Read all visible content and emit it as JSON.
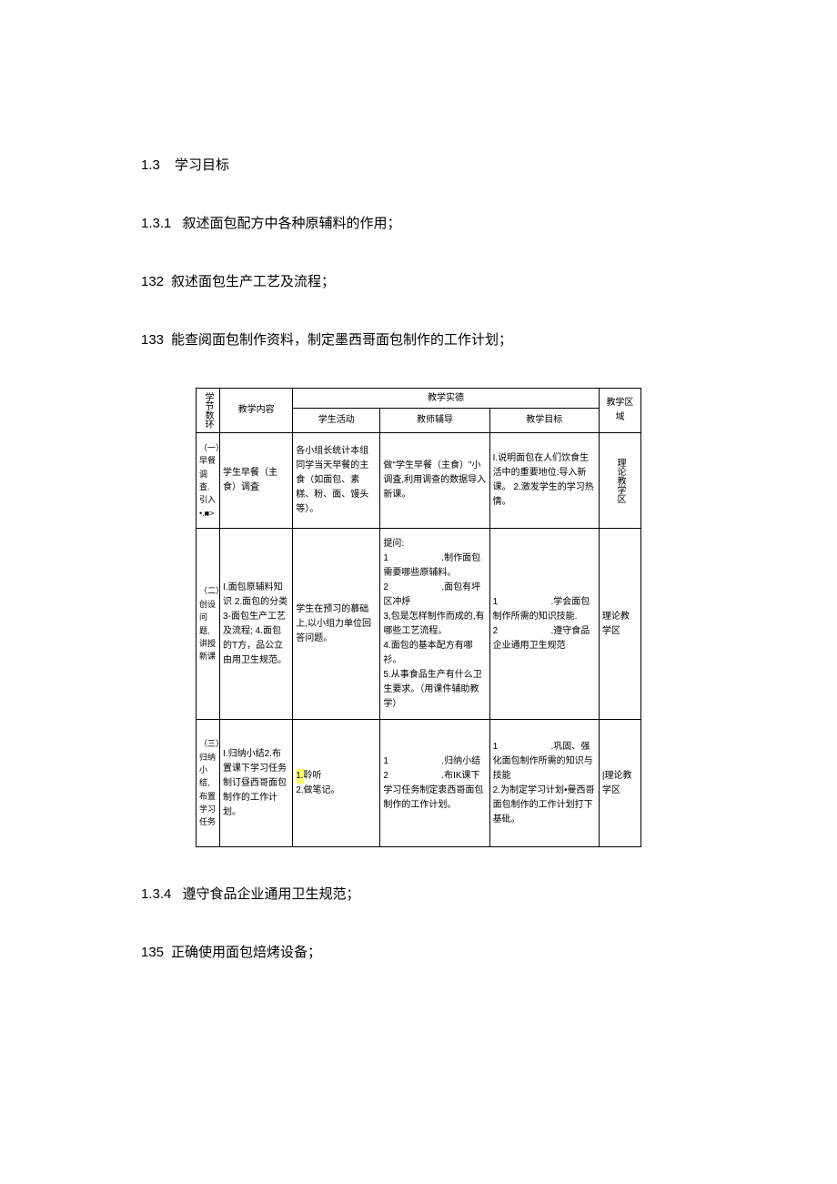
{
  "heading": {
    "num": "1.3",
    "text": "学习目标"
  },
  "items": [
    {
      "num": "1.3.1",
      "text": "叙述面包配方中各种原辅料的作用；"
    },
    {
      "num": "132",
      "text": "叙述面包生产工艺及流程；"
    },
    {
      "num": "133",
      "text": "能查阅面包制作资料，制定墨西哥面包制作的工作计划；"
    }
  ],
  "items_after": [
    {
      "num": "1.3.4",
      "text": "遵守食品企业通用卫生规范；"
    },
    {
      "num": "135",
      "text": "正确使用面包焙烤设备；"
    }
  ],
  "table": {
    "head": {
      "col1": "学节数环",
      "col2": "教学内容",
      "group": "教学实德",
      "sub1": "学生活动",
      "sub2": "教师辅导",
      "sub3": "教学目标",
      "col6": "教学区域"
    },
    "rows": [
      {
        "env": "（一）早餐调査.引入\n•.■>",
        "content": "学生早餐（主食）调査",
        "student": "各小组长统计本组同学当天早餐的主食（如面包、素糕、粉、面、馒头等）。",
        "teacher": "做\"学生早餐（主食）\"小调査,利用调查的数据导入新课。",
        "goal": "I.说明面包在人们饮食生活中的重要地位:导入新课。\n2.激发学生的学习热情。",
        "area": "理论教学区"
      },
      {
        "env": "（二）创设问题,讲授新课",
        "content": "I.面包原辅料知识\n2.面包的分类\n3-面包生产工艺及流程;\n4.面包的T方，品公立由用卫生规范。",
        "student": "学生在预习的慕础上,以小组力单位回答问题。",
        "teacher": "提问:\n1                     .制作面包需要哪些原辅料。\n2                     .面包有坪区冲烀\n3,包是怎样制作而成的,有哪些工艺流程。\n4.面包的基本配方有哪衫。\n5.从事食品生产有什么卫生要求。（用课件辅助教学）",
        "goal": "1                     .学会面包制作所需的知识技能.\n2                     .遵守食品企业通用卫生规范",
        "area": "理论教学区"
      },
      {
        "env": "（三）归纳小结,布置学习任务",
        "content": "I.归纳小结2.布置课下学习任务制订昼西哥面包制作的工作计划。",
        "student_hl": "1.",
        "student_rest": "聆听\n2.做笔记。",
        "teacher": "1                     .归纳小结\n2                     .布IK课下学习任务制定衷西哥面包制作的工作计划。",
        "goal": "1                     .巩固、强化面包制作所需的知识与技能\n2.为制定学习计划•曼西哥面包制作的工作计划打下基砒。",
        "area": "|理论教学区"
      }
    ]
  }
}
